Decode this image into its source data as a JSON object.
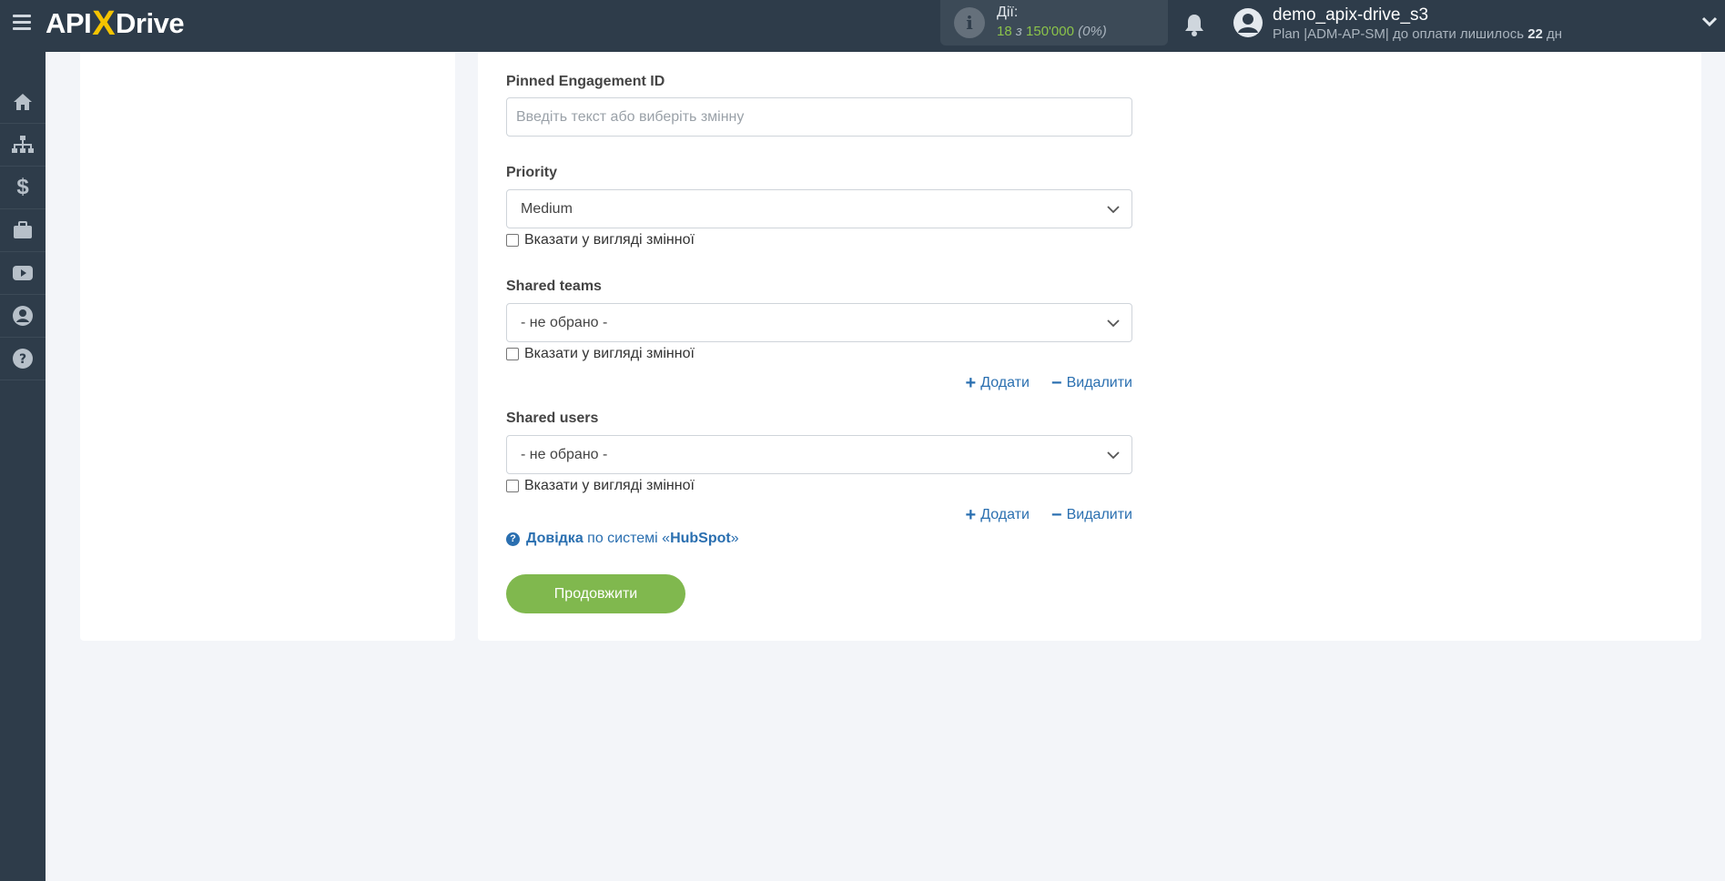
{
  "header": {
    "logo_left": "API",
    "logo_x": "X",
    "logo_right": "Drive",
    "actions_label": "Дії:",
    "actions_used": "18",
    "actions_sep": "з",
    "actions_total": "150'000",
    "actions_pct": "(0%)",
    "user_name": "demo_apix-drive_s3",
    "plan_prefix": "Plan |ADM-AP-SM| до оплати лишилось ",
    "plan_days": "22",
    "plan_suffix": " дн"
  },
  "sidebar": {
    "items": [
      {
        "icon": "home-icon"
      },
      {
        "icon": "sitemap-icon"
      },
      {
        "icon": "dollar-icon"
      },
      {
        "icon": "briefcase-icon"
      },
      {
        "icon": "youtube-icon"
      },
      {
        "icon": "user-circle-icon"
      },
      {
        "icon": "help-icon"
      }
    ]
  },
  "form": {
    "pinned": {
      "label": "Pinned Engagement ID",
      "placeholder": "Введіть текст або виберіть змінну"
    },
    "priority": {
      "label": "Priority",
      "value": "Medium",
      "checkbox": "Вказати у вигляді змінної"
    },
    "shared_teams": {
      "label": "Shared teams",
      "value": "- не обрано -",
      "checkbox": "Вказати у вигляді змінної",
      "add": "Додати",
      "remove": "Видалити"
    },
    "shared_users": {
      "label": "Shared users",
      "value": "- не обрано -",
      "checkbox": "Вказати у вигляді змінної",
      "add": "Додати",
      "remove": "Видалити"
    },
    "help": {
      "bold": "Довідка",
      "text": " по системі «",
      "system": "HubSpot",
      "end": "»"
    },
    "continue": "Продовжити"
  },
  "colors": {
    "topbar": "#2e3c4a",
    "accent_green": "#80b84e",
    "link_blue": "#2a6fb0",
    "logo_x": "#f5c400"
  }
}
